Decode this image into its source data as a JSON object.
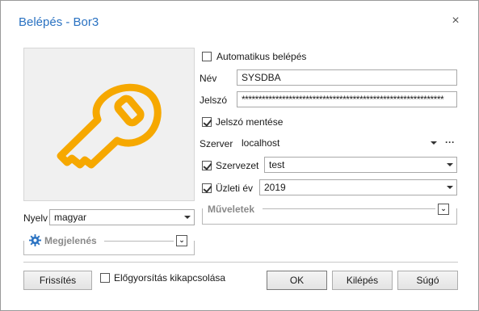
{
  "window": {
    "title": "Belépés - Bor3",
    "close_glyph": "×"
  },
  "login": {
    "auto_login_label": "Automatikus belépés",
    "auto_login_checked": false,
    "name_label": "Név",
    "name_value": "SYSDBA",
    "password_label": "Jelszó",
    "password_value": "************************************************************",
    "save_password_label": "Jelszó mentése",
    "save_password_checked": true,
    "server_label": "Szerver",
    "server_value": "localhost",
    "server_more": "···",
    "org_label": "Szervezet",
    "org_checked": true,
    "org_value": "test",
    "year_label": "Üzleti év",
    "year_checked": true,
    "year_value": "2019"
  },
  "language": {
    "label": "Nyelv",
    "value": "magyar"
  },
  "groups": {
    "operations_label": "Műveletek",
    "appearance_label": "Megjelenés"
  },
  "footer": {
    "refresh_label": "Frissítés",
    "prefetch_label": "Előgyorsítás kikapcsolása",
    "prefetch_checked": false,
    "ok_label": "OK",
    "exit_label": "Kilépés",
    "help_label": "Súgó"
  },
  "colors": {
    "title": "#2a72c2",
    "key_icon": "#f6a800",
    "gear_icon": "#2a72c2"
  },
  "icons": [
    "key-icon",
    "gear-icon",
    "close-icon",
    "expand-icon",
    "chevron-down-icon"
  ]
}
